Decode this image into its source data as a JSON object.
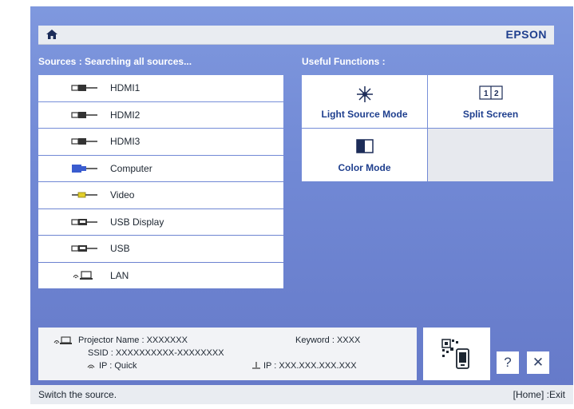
{
  "header": {
    "brand": "EPSON"
  },
  "sources": {
    "title": "Sources : Searching all sources...",
    "items": [
      {
        "label": "HDMI1",
        "icon": "hdmi-connector-icon"
      },
      {
        "label": "HDMI2",
        "icon": "hdmi-connector-icon"
      },
      {
        "label": "HDMI3",
        "icon": "hdmi-connector-icon"
      },
      {
        "label": "Computer",
        "icon": "computer-connector-icon"
      },
      {
        "label": "Video",
        "icon": "video-connector-icon"
      },
      {
        "label": "USB Display",
        "icon": "usb-connector-icon"
      },
      {
        "label": "USB",
        "icon": "usb-connector-icon"
      },
      {
        "label": "LAN",
        "icon": "lan-network-icon"
      }
    ]
  },
  "functions": {
    "title": "Useful Functions :",
    "items": [
      {
        "label": "Light Source Mode",
        "icon": "light-burst-icon"
      },
      {
        "label": "Split Screen",
        "icon": "split-screen-icon",
        "icon_text": "1|2"
      },
      {
        "label": "Color Mode",
        "icon": "color-mode-icon"
      }
    ]
  },
  "info": {
    "projector_name": "Projector Name : XXXXXXX",
    "keyword": "Keyword : XXXX",
    "ssid": "SSID : XXXXXXXXXX-XXXXXXXX",
    "ip_mode": "IP : Quick",
    "ip": "IP : XXX.XXX.XXX.XXX"
  },
  "buttons": {
    "help": "?",
    "close": "✕"
  },
  "status": {
    "message": "Switch the source.",
    "exit_hint": "[Home] :Exit"
  },
  "colors": {
    "accent": "#1f3f8e",
    "background": "#7189d5",
    "panel": "#ffffff"
  }
}
